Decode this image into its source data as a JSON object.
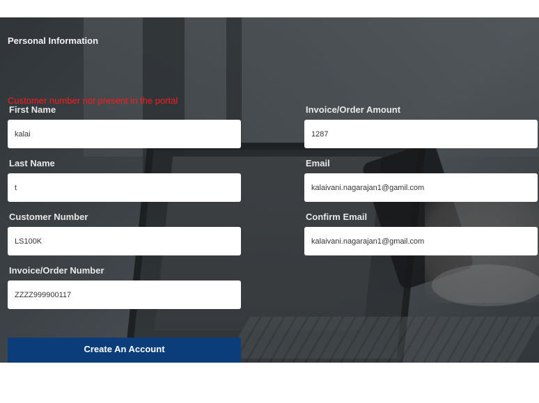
{
  "section_title": "Personal Information",
  "error_message": "Customer number not present in the portal",
  "fields": {
    "first_name": {
      "label": "First Name",
      "value": "kalai"
    },
    "last_name": {
      "label": "Last Name",
      "value": "t"
    },
    "customer_number": {
      "label": "Customer Number",
      "value": "LS100K"
    },
    "invoice_number": {
      "label": "Invoice/Order Number",
      "value": "ZZZZ999900117"
    },
    "invoice_amount": {
      "label": "Invoice/Order Amount",
      "value": "1287"
    },
    "email": {
      "label": "Email",
      "value": "kalaivani.nagarajan1@gamil.com"
    },
    "confirm_email": {
      "label": "Confirm Email",
      "value": "kalaivani.nagarajan1@gmail.com"
    }
  },
  "submit_label": "Create An Account",
  "colors": {
    "error": "#ff1a1a",
    "button": "#0a3d7a"
  }
}
